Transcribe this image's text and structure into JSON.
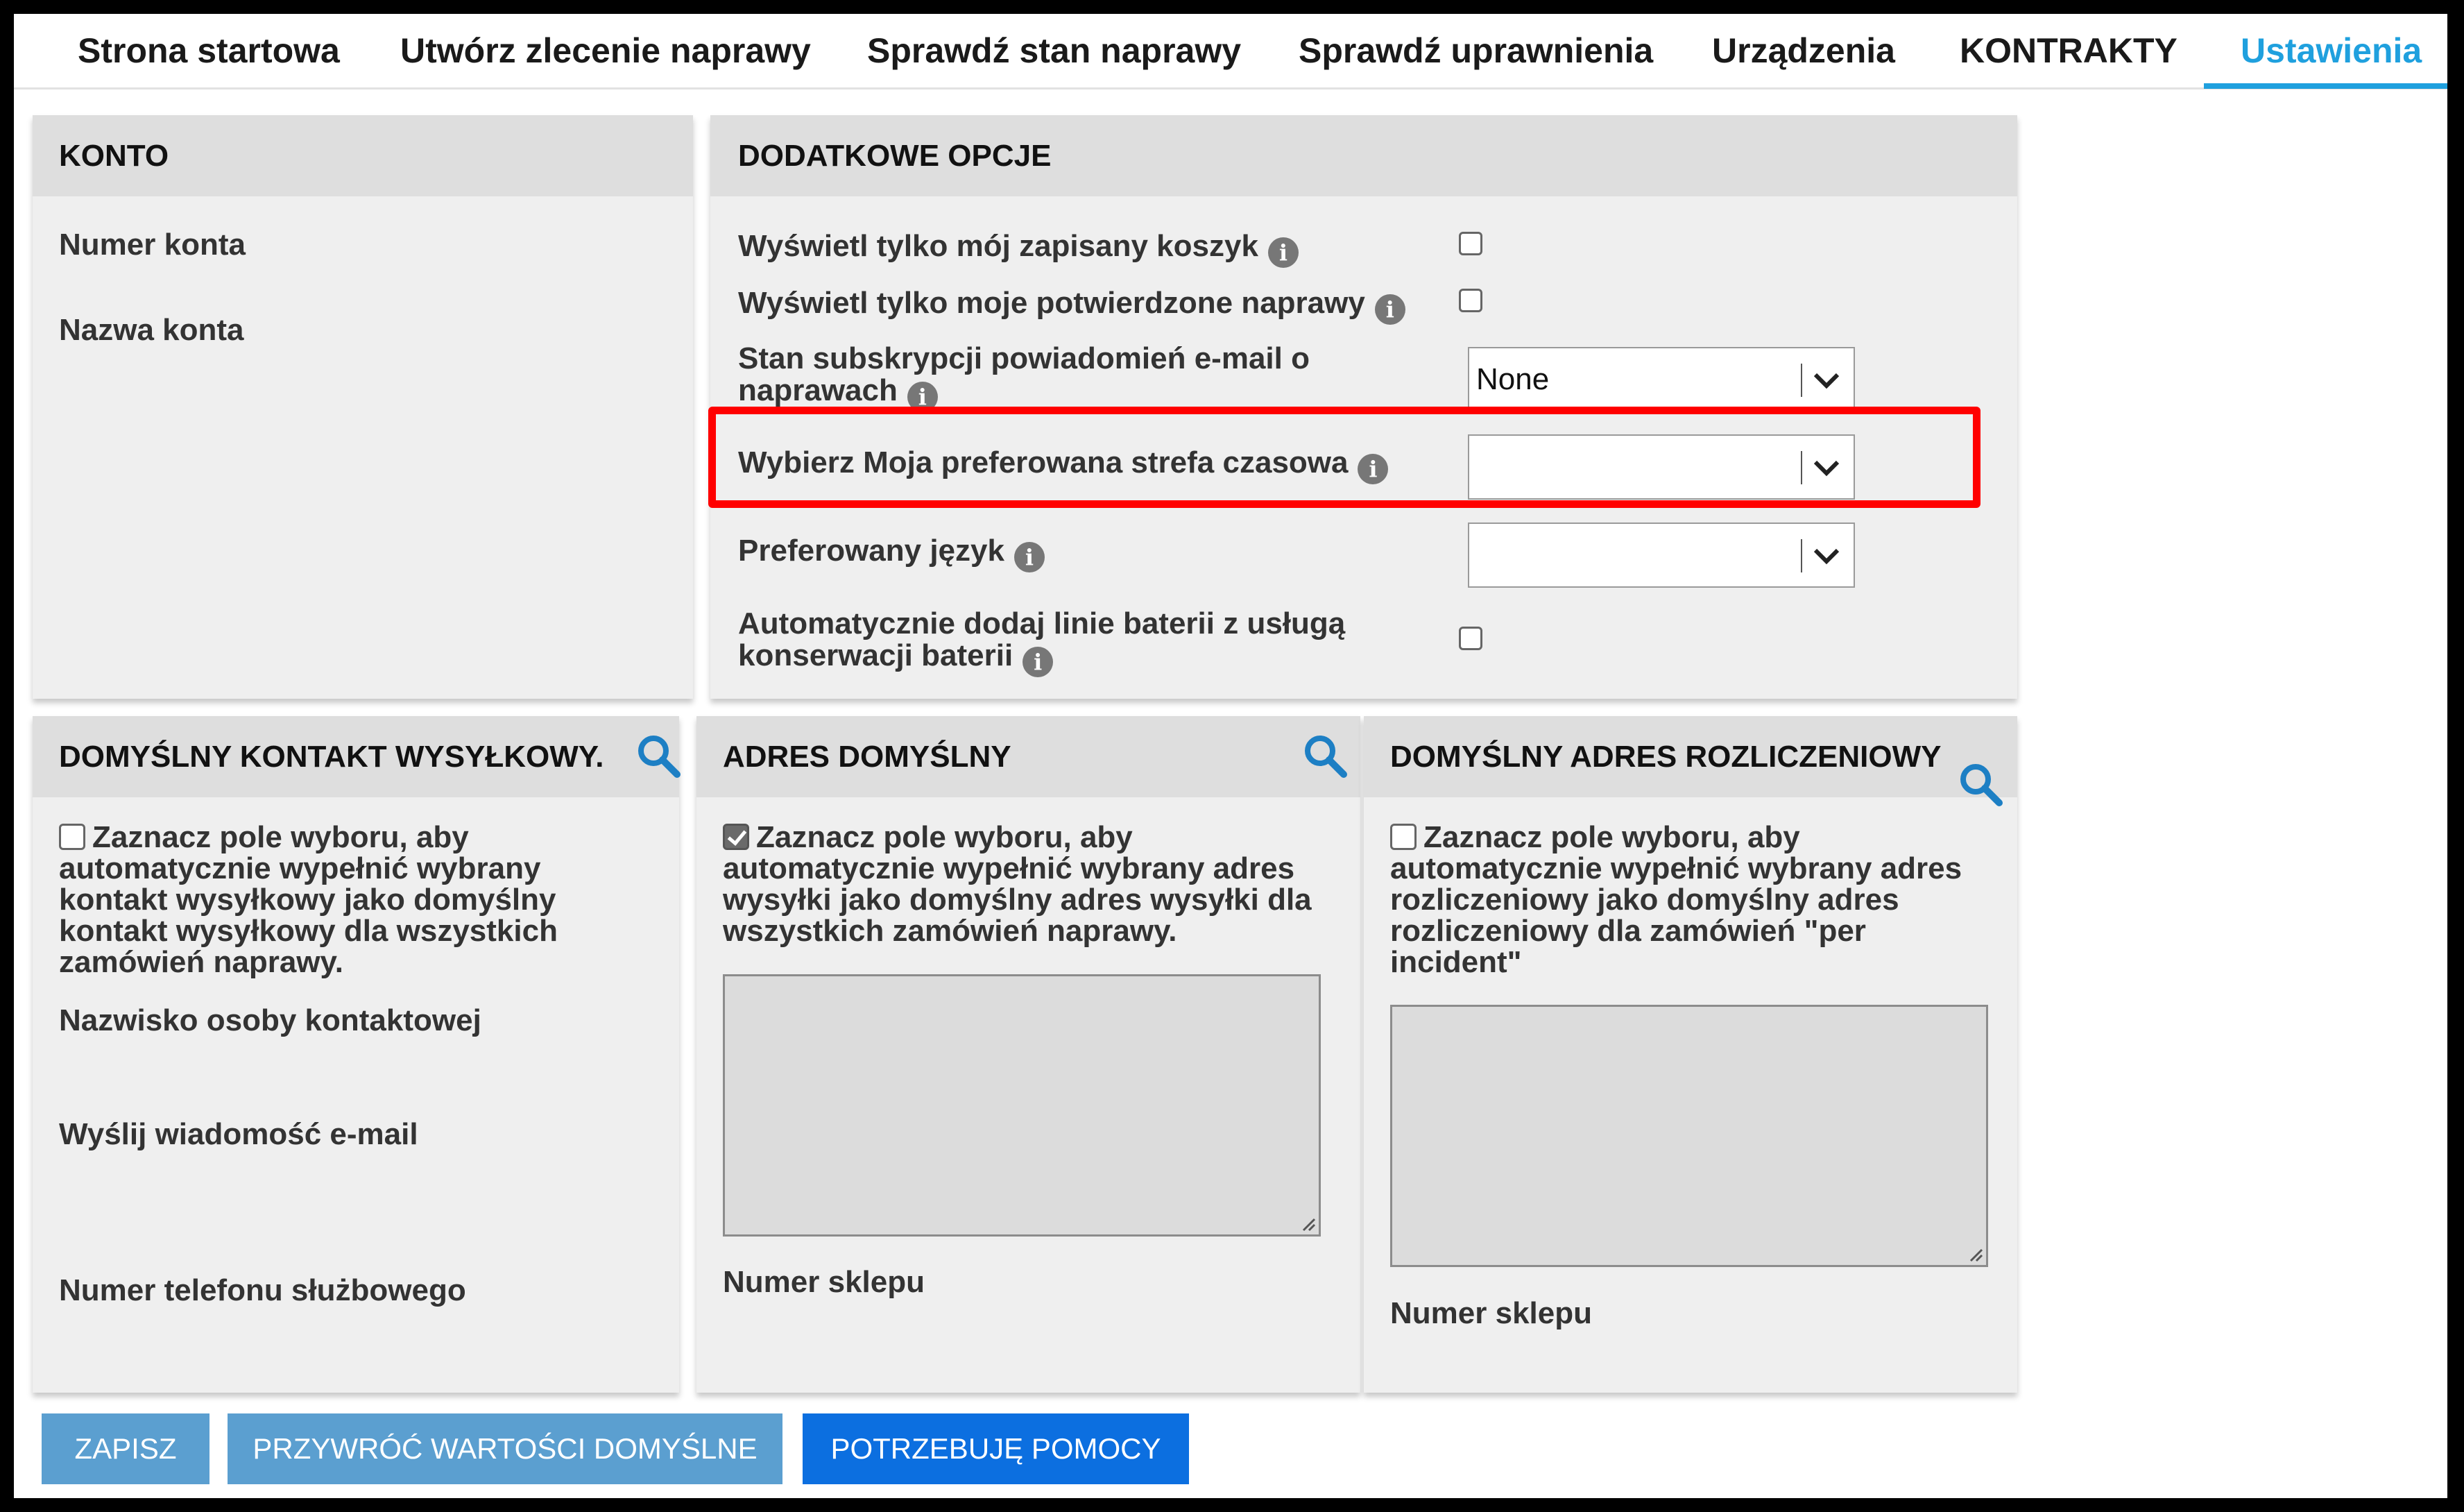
{
  "nav": {
    "items": [
      {
        "label": "Strona startowa"
      },
      {
        "label": "Utwórz zlecenie naprawy"
      },
      {
        "label": "Sprawdź stan naprawy"
      },
      {
        "label": "Sprawdź uprawnienia"
      },
      {
        "label": "Urządzenia"
      },
      {
        "label": "KONTRAKTY"
      },
      {
        "label": "Ustawienia",
        "active": true
      }
    ]
  },
  "konto": {
    "title": "KONTO",
    "account_number_label": "Numer konta",
    "account_name_label": "Nazwa konta"
  },
  "options": {
    "title": "DODATKOWE OPCJE",
    "saved_cart_label": "Wyświetl tylko mój zapisany koszyk",
    "confirmed_repairs_label": "Wyświetl tylko moje potwierdzone naprawy",
    "email_subscription_label": "Stan subskrypcji powiadomień e-mail o naprawach",
    "email_subscription_value": "None",
    "timezone_label": "Wybierz Moja preferowana strefa czasowa",
    "timezone_value": "",
    "language_label": "Preferowany język",
    "language_value": "",
    "battery_label": "Automatycznie dodaj linie baterii z usługą konserwacji baterii",
    "info_glyph": "i"
  },
  "shipping_contact": {
    "title": "DOMYŚLNY KONTAKT WYSYŁKOWY.",
    "checkbox_text": "Zaznacz pole wyboru, aby automatycznie wypełnić wybrany kontakt wysyłkowy jako domyślny kontakt wysyłkowy dla wszystkich zamówień naprawy.",
    "contact_name_label": "Nazwisko osoby kontaktowej",
    "email_label": "Wyślij wiadomość e-mail",
    "phone_label": "Numer telefonu służbowego"
  },
  "default_address": {
    "title": "ADRES DOMYŚLNY",
    "checkbox_text": "Zaznacz pole wyboru, aby automatycznie wypełnić wybrany adres wysyłki jako domyślny adres wysyłki dla wszystkich zamówień naprawy.",
    "checked": true,
    "store_number_label": "Numer sklepu"
  },
  "billing_address": {
    "title": "DOMYŚLNY ADRES ROZLICZENIOWY",
    "checkbox_text": "Zaznacz pole wyboru, aby automatycznie wypełnić wybrany adres rozliczeniowy jako domyślny adres rozliczeniowy dla zamówień \"per incident\"",
    "store_number_label": "Numer sklepu"
  },
  "buttons": {
    "save": "ZAPISZ",
    "restore_defaults": "PRZYWRÓĆ WARTOŚCI DOMYŚLNE",
    "need_help": "POTRZEBUJĘ POMOCY"
  },
  "colors": {
    "accent": "#1fa0de",
    "highlight": "#ff0000",
    "primary_button": "#0c6fe0",
    "muted_button": "#5b9fd0"
  }
}
